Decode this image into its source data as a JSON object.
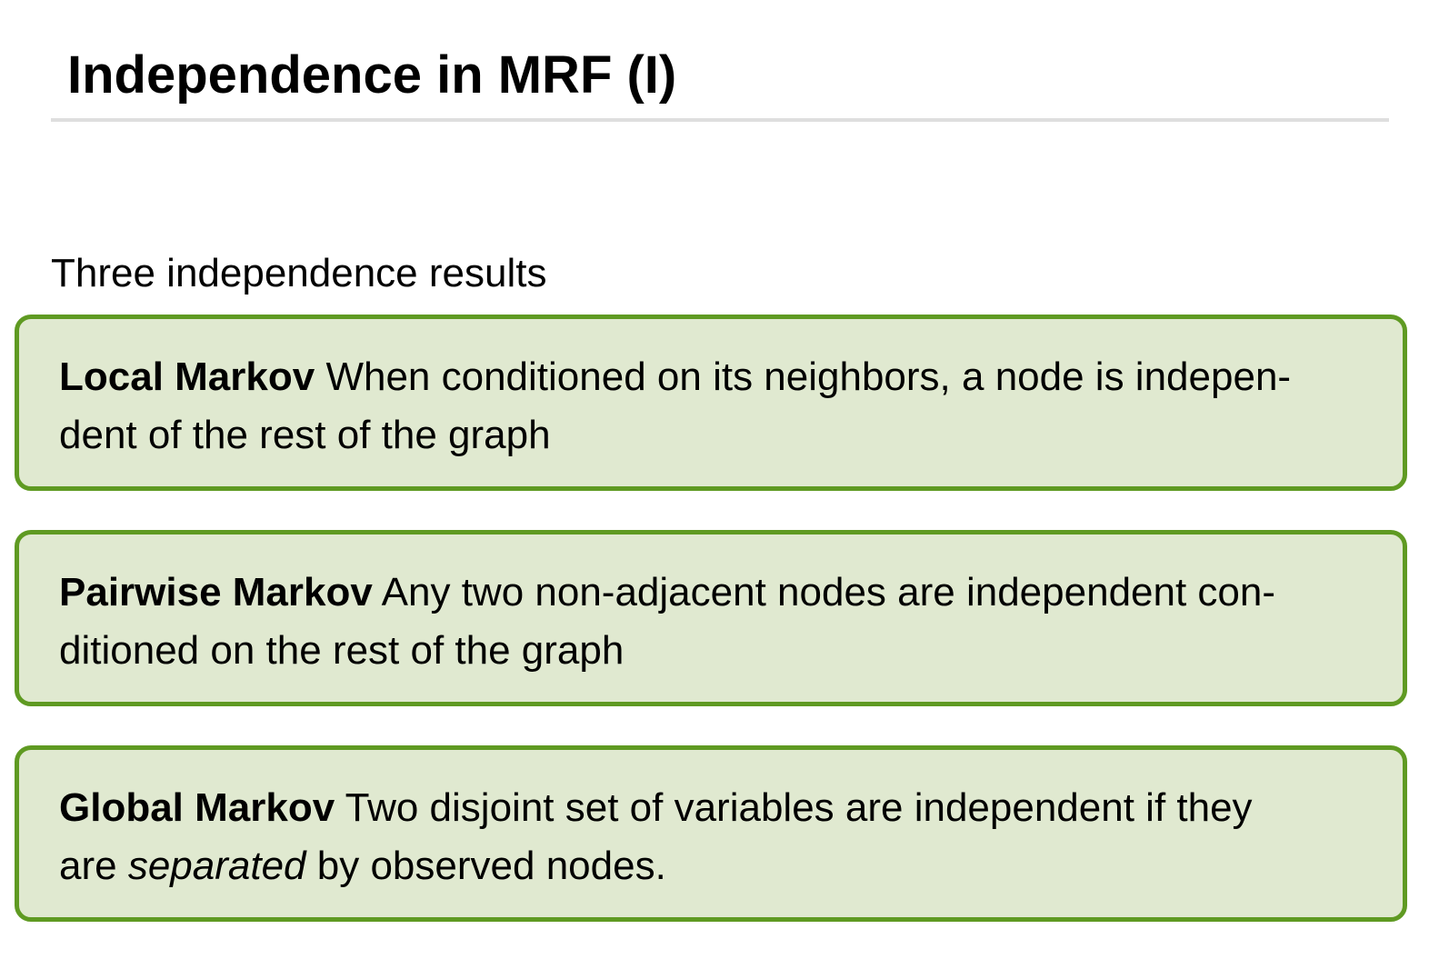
{
  "slide": {
    "title": "Independence in MRF (I)",
    "intro": "Three independence results"
  },
  "results": [
    {
      "term": "Local Markov",
      "line1": "When conditioned on its neighbors, a node is indepen-",
      "line2": "dent of the rest of the graph"
    },
    {
      "term": "Pairwise Markov",
      "line1": "Any two non-adjacent nodes are independent con-",
      "line2": "ditioned on the rest of the graph"
    },
    {
      "term": "Global Markov",
      "line1": "Two disjoint set of variables are independent if they",
      "line2_before": "are",
      "line2_emphasis": "separated",
      "line2_after": "by observed nodes."
    }
  ],
  "colors": {
    "box_border": "#5f9a22",
    "box_fill": "#e0e9d0",
    "rule": "#dedede"
  }
}
